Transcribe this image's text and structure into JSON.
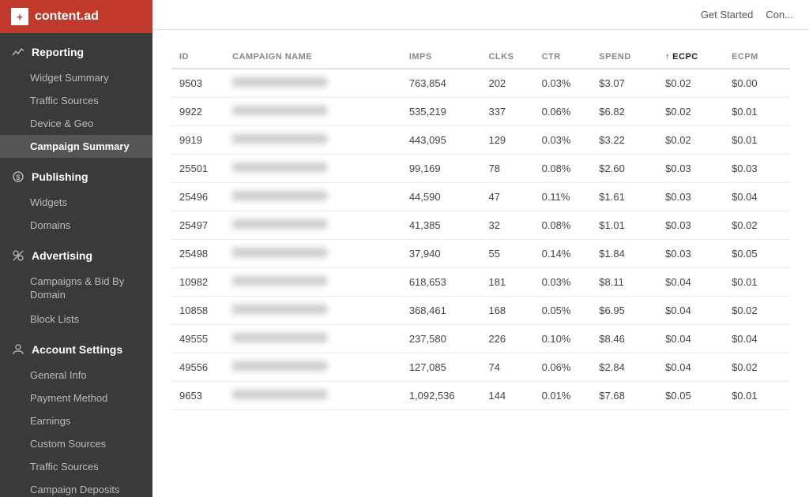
{
  "logo": {
    "icon": "+",
    "text": "content.ad"
  },
  "topbar": {
    "links": [
      "Get Started",
      "Con..."
    ]
  },
  "sidebar": {
    "sections": [
      {
        "id": "reporting",
        "label": "Reporting",
        "icon": "chart",
        "items": [
          {
            "id": "widget-summary",
            "label": "Widget Summary",
            "active": false
          },
          {
            "id": "traffic-sources",
            "label": "Traffic Sources",
            "active": false
          },
          {
            "id": "device-geo",
            "label": "Device & Geo",
            "active": false
          },
          {
            "id": "campaign-summary",
            "label": "Campaign Summary",
            "active": true
          }
        ]
      },
      {
        "id": "publishing",
        "label": "Publishing",
        "icon": "dollar",
        "items": [
          {
            "id": "widgets",
            "label": "Widgets",
            "active": false
          },
          {
            "id": "domains",
            "label": "Domains",
            "active": false
          }
        ]
      },
      {
        "id": "advertising",
        "label": "Advertising",
        "icon": "tools",
        "items": [
          {
            "id": "campaigns-bid",
            "label": "Campaigns & Bid By Domain",
            "active": false
          },
          {
            "id": "block-lists",
            "label": "Block Lists",
            "active": false
          }
        ]
      },
      {
        "id": "account-settings",
        "label": "Account Settings",
        "icon": "person",
        "items": [
          {
            "id": "general-info",
            "label": "General Info",
            "active": false
          },
          {
            "id": "payment-method",
            "label": "Payment Method",
            "active": false
          },
          {
            "id": "earnings",
            "label": "Earnings",
            "active": false
          },
          {
            "id": "custom-sources",
            "label": "Custom Sources",
            "active": false
          },
          {
            "id": "traffic-sources-acct",
            "label": "Traffic Sources",
            "active": false
          },
          {
            "id": "campaign-deposits",
            "label": "Campaign Deposits",
            "active": false
          }
        ]
      }
    ]
  },
  "table": {
    "columns": [
      {
        "id": "id",
        "label": "ID",
        "sorted": false
      },
      {
        "id": "campaign_name",
        "label": "CAMPAIGN NAME",
        "sorted": false
      },
      {
        "id": "imps",
        "label": "IMPS",
        "sorted": false
      },
      {
        "id": "clks",
        "label": "CLKS",
        "sorted": false
      },
      {
        "id": "ctr",
        "label": "CTR",
        "sorted": false
      },
      {
        "id": "spend",
        "label": "SPEND",
        "sorted": false
      },
      {
        "id": "ecpc",
        "label": "ECPC",
        "sorted": true,
        "sort_dir": "asc"
      },
      {
        "id": "ecpm",
        "label": "ECPM",
        "sorted": false
      }
    ],
    "rows": [
      {
        "id": "9503",
        "campaign_name": "blurred text 1",
        "imps": "763,854",
        "clks": "202",
        "ctr": "0.03%",
        "spend": "$3.07",
        "ecpc": "$0.02",
        "ecpm": "$0.00"
      },
      {
        "id": "9922",
        "campaign_name": "blurred text 2",
        "imps": "535,219",
        "clks": "337",
        "ctr": "0.06%",
        "spend": "$6.82",
        "ecpc": "$0.02",
        "ecpm": "$0.01"
      },
      {
        "id": "9919",
        "campaign_name": "blurred text 3",
        "imps": "443,095",
        "clks": "129",
        "ctr": "0.03%",
        "spend": "$3.22",
        "ecpc": "$0.02",
        "ecpm": "$0.01"
      },
      {
        "id": "25501",
        "campaign_name": "blurred text 4",
        "imps": "99,169",
        "clks": "78",
        "ctr": "0.08%",
        "spend": "$2.60",
        "ecpc": "$0.03",
        "ecpm": "$0.03"
      },
      {
        "id": "25496",
        "campaign_name": "blurred text 5",
        "imps": "44,590",
        "clks": "47",
        "ctr": "0.11%",
        "spend": "$1.61",
        "ecpc": "$0.03",
        "ecpm": "$0.04"
      },
      {
        "id": "25497",
        "campaign_name": "blurred text 6",
        "imps": "41,385",
        "clks": "32",
        "ctr": "0.08%",
        "spend": "$1.01",
        "ecpc": "$0.03",
        "ecpm": "$0.02"
      },
      {
        "id": "25498",
        "campaign_name": "blurred text 7",
        "imps": "37,940",
        "clks": "55",
        "ctr": "0.14%",
        "spend": "$1.84",
        "ecpc": "$0.03",
        "ecpm": "$0.05"
      },
      {
        "id": "10982",
        "campaign_name": "blurred text 8",
        "imps": "618,653",
        "clks": "181",
        "ctr": "0.03%",
        "spend": "$8.11",
        "ecpc": "$0.04",
        "ecpm": "$0.01"
      },
      {
        "id": "10858",
        "campaign_name": "blurred text 9",
        "imps": "368,461",
        "clks": "168",
        "ctr": "0.05%",
        "spend": "$6.95",
        "ecpc": "$0.04",
        "ecpm": "$0.02"
      },
      {
        "id": "49555",
        "campaign_name": "blurred text 10",
        "imps": "237,580",
        "clks": "226",
        "ctr": "0.10%",
        "spend": "$8.46",
        "ecpc": "$0.04",
        "ecpm": "$0.04"
      },
      {
        "id": "49556",
        "campaign_name": "blurred text 11",
        "imps": "127,085",
        "clks": "74",
        "ctr": "0.06%",
        "spend": "$2.84",
        "ecpc": "$0.04",
        "ecpm": "$0.02"
      },
      {
        "id": "9653",
        "campaign_name": "blurred text 12",
        "imps": "1,092,536",
        "clks": "144",
        "ctr": "0.01%",
        "spend": "$7.68",
        "ecpc": "$0.05",
        "ecpm": "$0.01"
      }
    ]
  }
}
